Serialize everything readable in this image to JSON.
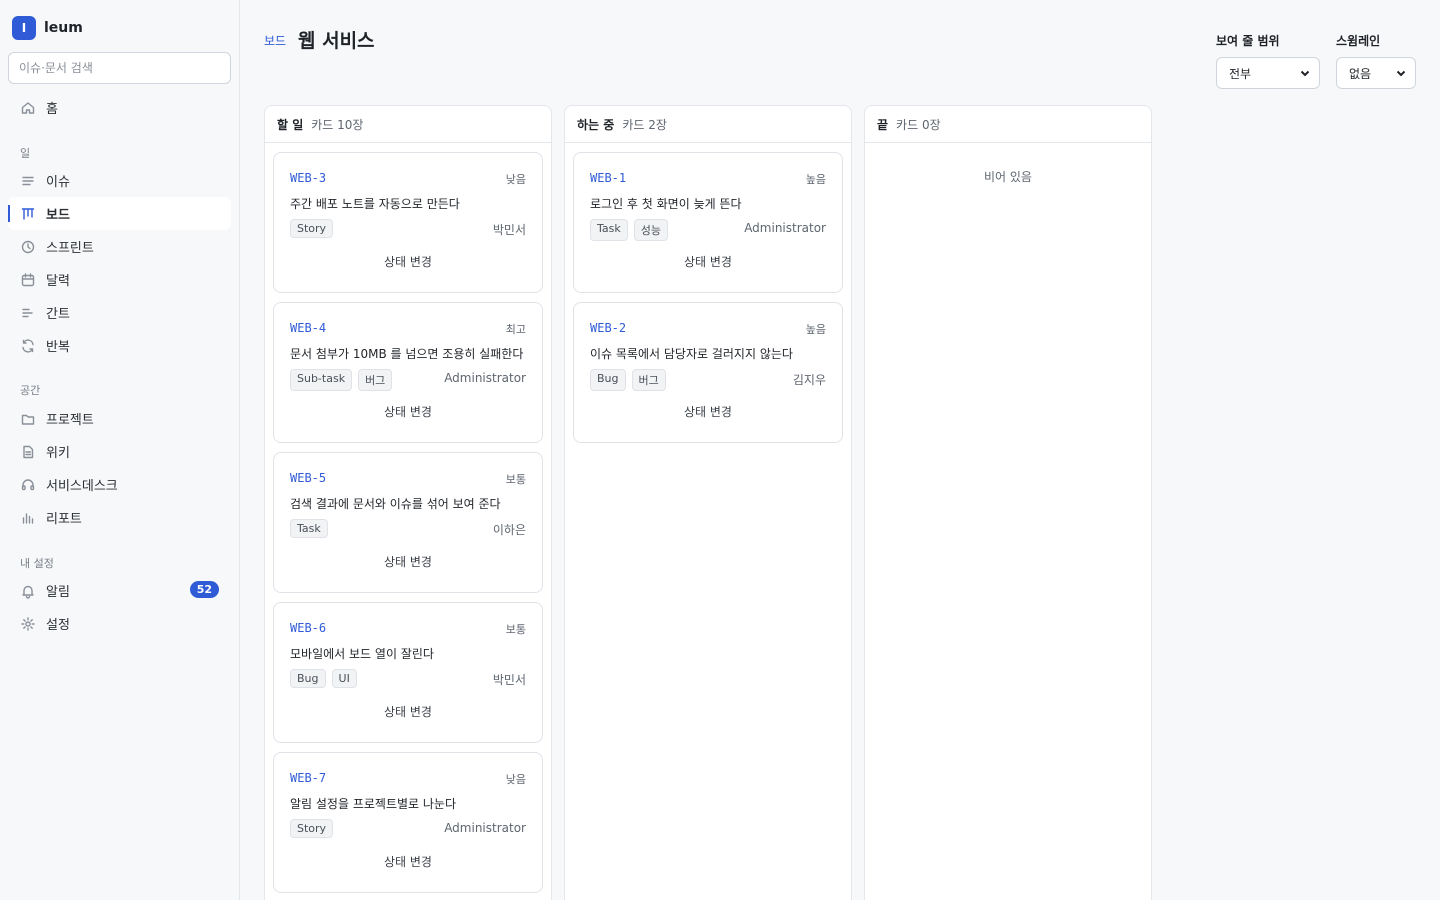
{
  "app": {
    "logo_letter": "I",
    "name": "leum"
  },
  "search": {
    "placeholder": "이슈·문서 검색"
  },
  "nav": {
    "home": "홈",
    "section_work": "일",
    "issues": "이슈",
    "board": "보드",
    "sprint": "스프린트",
    "calendar": "달력",
    "gantt": "간트",
    "recurring": "반복",
    "section_space": "공간",
    "projects": "프로젝트",
    "wiki": "위키",
    "servicedesk": "서비스데스크",
    "reports": "리포트",
    "section_settings": "내 설정",
    "notifications": "알림",
    "notifications_count": "52",
    "settings": "설정"
  },
  "header": {
    "breadcrumb": "보드",
    "title": "웹 서비스"
  },
  "filters": {
    "scope_label": "보여 줄 범위",
    "scope_value": "전부",
    "swimlane_label": "스윔레인",
    "swimlane_value": "없음"
  },
  "columns": [
    {
      "name": "할 일",
      "count": "카드 10장",
      "cards": [
        {
          "key": "WEB-3",
          "priority": "낮음",
          "title": "주간 배포 노트를 자동으로 만든다",
          "tags": [
            "Story"
          ],
          "assignee": "박민서",
          "action": "상태 변경"
        },
        {
          "key": "WEB-4",
          "priority": "최고",
          "title": "문서 첨부가 10MB 를 넘으면 조용히 실패한다",
          "tags": [
            "Sub-task",
            "버그"
          ],
          "assignee": "Administrator",
          "action": "상태 변경"
        },
        {
          "key": "WEB-5",
          "priority": "보통",
          "title": "검색 결과에 문서와 이슈를 섞어 보여 준다",
          "tags": [
            "Task"
          ],
          "assignee": "이하은",
          "action": "상태 변경"
        },
        {
          "key": "WEB-6",
          "priority": "보통",
          "title": "모바일에서 보드 열이 잘린다",
          "tags": [
            "Bug",
            "UI"
          ],
          "assignee": "박민서",
          "action": "상태 변경"
        },
        {
          "key": "WEB-7",
          "priority": "낮음",
          "title": "알림 설정을 프로젝트별로 나눈다",
          "tags": [
            "Story"
          ],
          "assignee": "Administrator",
          "action": "상태 변경"
        }
      ]
    },
    {
      "name": "하는 중",
      "count": "카드 2장",
      "cards": [
        {
          "key": "WEB-1",
          "priority": "높음",
          "title": "로그인 후 첫 화면이 늦게 뜬다",
          "tags": [
            "Task",
            "성능"
          ],
          "assignee": "Administrator",
          "action": "상태 변경"
        },
        {
          "key": "WEB-2",
          "priority": "높음",
          "title": "이슈 목록에서 담당자로 걸러지지 않는다",
          "tags": [
            "Bug",
            "버그"
          ],
          "assignee": "김지우",
          "action": "상태 변경"
        }
      ]
    },
    {
      "name": "끝",
      "count": "카드 0장",
      "empty_text": "비어 있음",
      "cards": []
    }
  ]
}
